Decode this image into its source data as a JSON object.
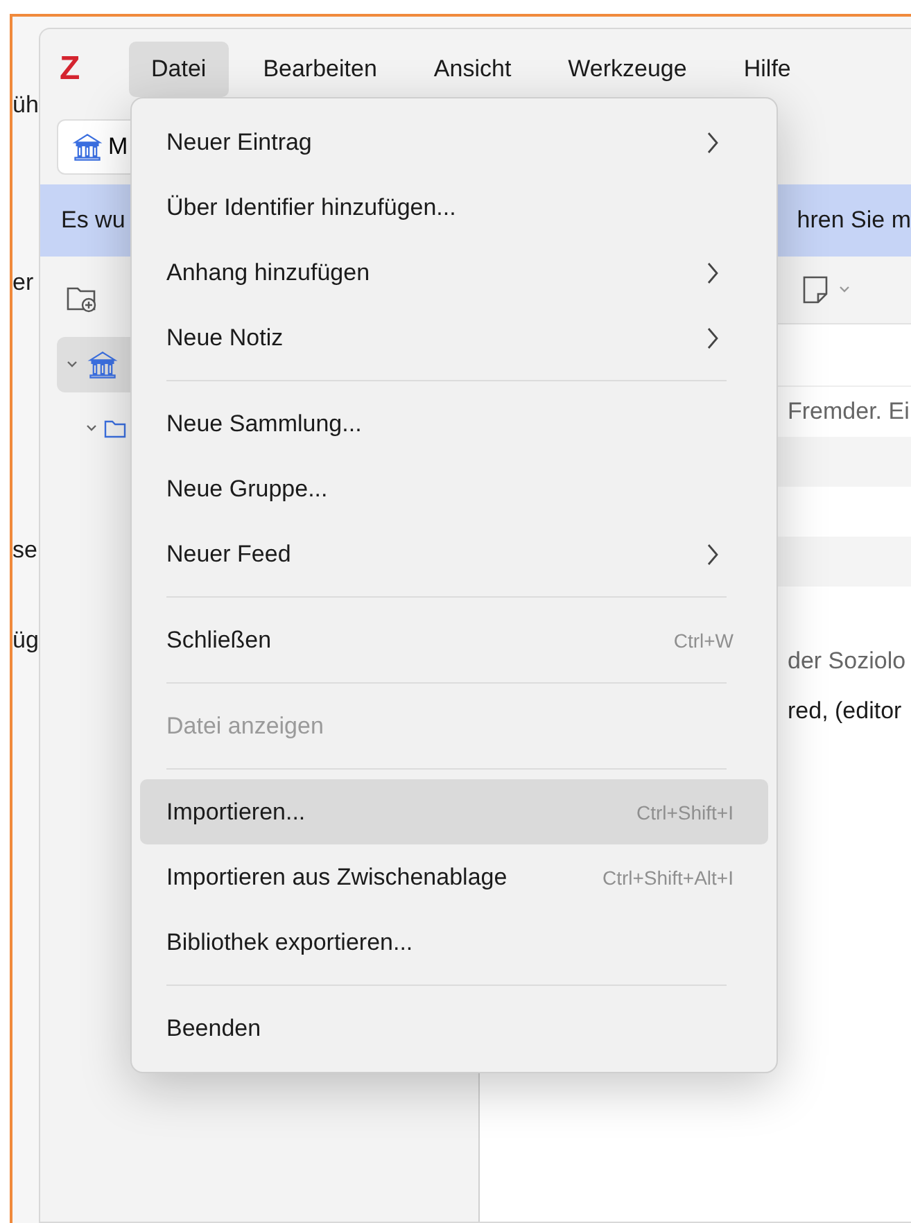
{
  "background_window": {
    "text_fragments": [
      "üh",
      "er",
      "se",
      "üg"
    ]
  },
  "menubar": {
    "logo": "Z",
    "items": [
      {
        "label": "Datei",
        "selected": true
      },
      {
        "label": "Bearbeiten",
        "selected": false
      },
      {
        "label": "Ansicht",
        "selected": false
      },
      {
        "label": "Werkzeuge",
        "selected": false
      },
      {
        "label": "Hilfe",
        "selected": false
      }
    ]
  },
  "toolbar": {
    "library_button": "M"
  },
  "banner": {
    "text_start": "Es wu",
    "text_end": "hren Sie m"
  },
  "item_rows": [
    "Fremder. Ei",
    "der Soziolo",
    "red, (editor"
  ],
  "menu": {
    "items": [
      {
        "kind": "item",
        "label": "Neuer Eintrag",
        "submenu": true,
        "disabled": false,
        "selected": false
      },
      {
        "kind": "item",
        "label": "Über Identifier hinzufügen...",
        "submenu": false,
        "disabled": false,
        "selected": false
      },
      {
        "kind": "item",
        "label": "Anhang hinzufügen",
        "submenu": true,
        "disabled": false,
        "selected": false
      },
      {
        "kind": "item",
        "label": "Neue Notiz",
        "submenu": true,
        "disabled": false,
        "selected": false
      },
      {
        "kind": "separator"
      },
      {
        "kind": "item",
        "label": "Neue Sammlung...",
        "submenu": false,
        "disabled": false,
        "selected": false
      },
      {
        "kind": "item",
        "label": "Neue Gruppe...",
        "submenu": false,
        "disabled": false,
        "selected": false
      },
      {
        "kind": "item",
        "label": "Neuer Feed",
        "submenu": true,
        "disabled": false,
        "selected": false
      },
      {
        "kind": "separator"
      },
      {
        "kind": "item",
        "label": "Schließen",
        "shortcut": "Ctrl+W",
        "submenu": false,
        "disabled": false,
        "selected": false
      },
      {
        "kind": "separator"
      },
      {
        "kind": "item",
        "label": "Datei anzeigen",
        "submenu": false,
        "disabled": true,
        "selected": false
      },
      {
        "kind": "separator"
      },
      {
        "kind": "item",
        "label": "Importieren...",
        "shortcut": "Ctrl+Shift+I",
        "submenu": false,
        "disabled": false,
        "selected": true
      },
      {
        "kind": "item",
        "label": "Importieren aus Zwischenablage",
        "shortcut": "Ctrl+Shift+Alt+I",
        "submenu": false,
        "disabled": false,
        "selected": false
      },
      {
        "kind": "item",
        "label": "Bibliothek exportieren...",
        "submenu": false,
        "disabled": false,
        "selected": false
      },
      {
        "kind": "separator"
      },
      {
        "kind": "item",
        "label": "Beenden",
        "submenu": false,
        "disabled": false,
        "selected": false
      }
    ]
  }
}
